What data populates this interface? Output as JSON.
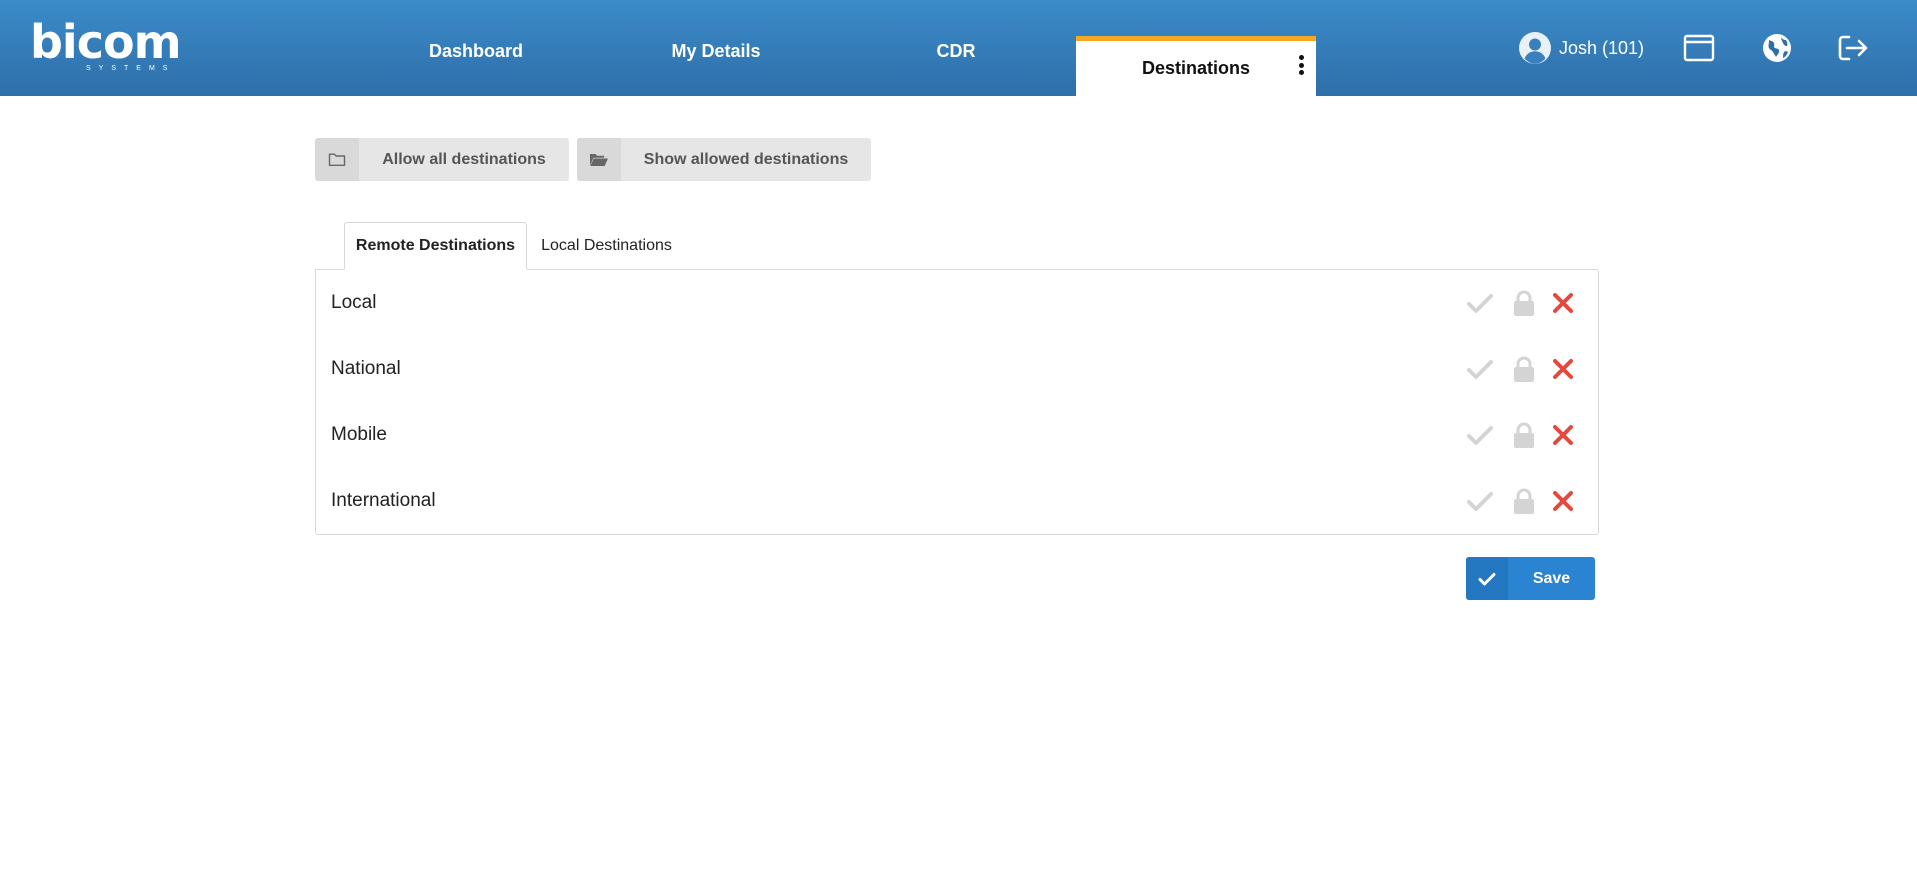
{
  "brand": {
    "logo_text": "bicom",
    "logo_sub": "SYSTEMS"
  },
  "nav": {
    "tabs": [
      {
        "label": "Dashboard"
      },
      {
        "label": "My Details"
      },
      {
        "label": "CDR"
      },
      {
        "label": "Destinations",
        "active": true
      }
    ]
  },
  "user": {
    "label": "Josh (101)"
  },
  "header_icons": [
    "user-avatar-icon",
    "window-icon",
    "globe-icon",
    "logout-icon"
  ],
  "actions": {
    "allow_all": "Allow all destinations",
    "show_allowed": "Show allowed destinations"
  },
  "tabs": {
    "remote": "Remote Destinations",
    "local": "Local Destinations"
  },
  "destinations": [
    {
      "name": "Local"
    },
    {
      "name": "National"
    },
    {
      "name": "Mobile"
    },
    {
      "name": "International"
    }
  ],
  "save_label": "Save",
  "colors": {
    "header": "#3b8bc9",
    "active_tab_accent": "#f5a623",
    "deny": "#e5483d",
    "inactive_icon": "#d4d4d4",
    "save_button": "#2b84d1"
  }
}
